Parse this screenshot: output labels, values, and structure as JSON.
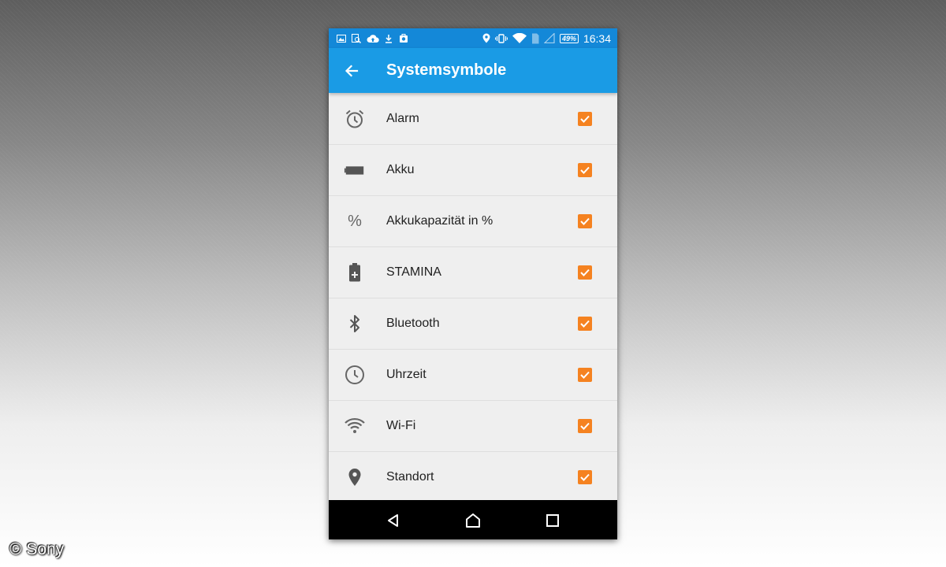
{
  "status_bar": {
    "battery_percent": "49%",
    "time": "16:34"
  },
  "app_bar": {
    "title": "Systemsymbole"
  },
  "settings": [
    {
      "label": "Alarm",
      "icon": "alarm-icon",
      "checked": true
    },
    {
      "label": "Akku",
      "icon": "battery-icon",
      "checked": true
    },
    {
      "label": "Akkukapazität in %",
      "icon": "percent-icon",
      "icon_glyph": "%",
      "checked": true
    },
    {
      "label": "STAMINA",
      "icon": "stamina-battery-icon",
      "checked": true
    },
    {
      "label": "Bluetooth",
      "icon": "bluetooth-icon",
      "checked": true
    },
    {
      "label": "Uhrzeit",
      "icon": "clock-icon",
      "checked": true
    },
    {
      "label": "Wi-Fi",
      "icon": "wifi-icon",
      "checked": true
    },
    {
      "label": "Standort",
      "icon": "location-icon",
      "checked": true
    }
  ],
  "copyright": "© Sony",
  "colors": {
    "app_bar": "#1a9be5",
    "status_bar": "#1488d8",
    "checkbox": "#f58220",
    "list_background": "#efefef"
  }
}
